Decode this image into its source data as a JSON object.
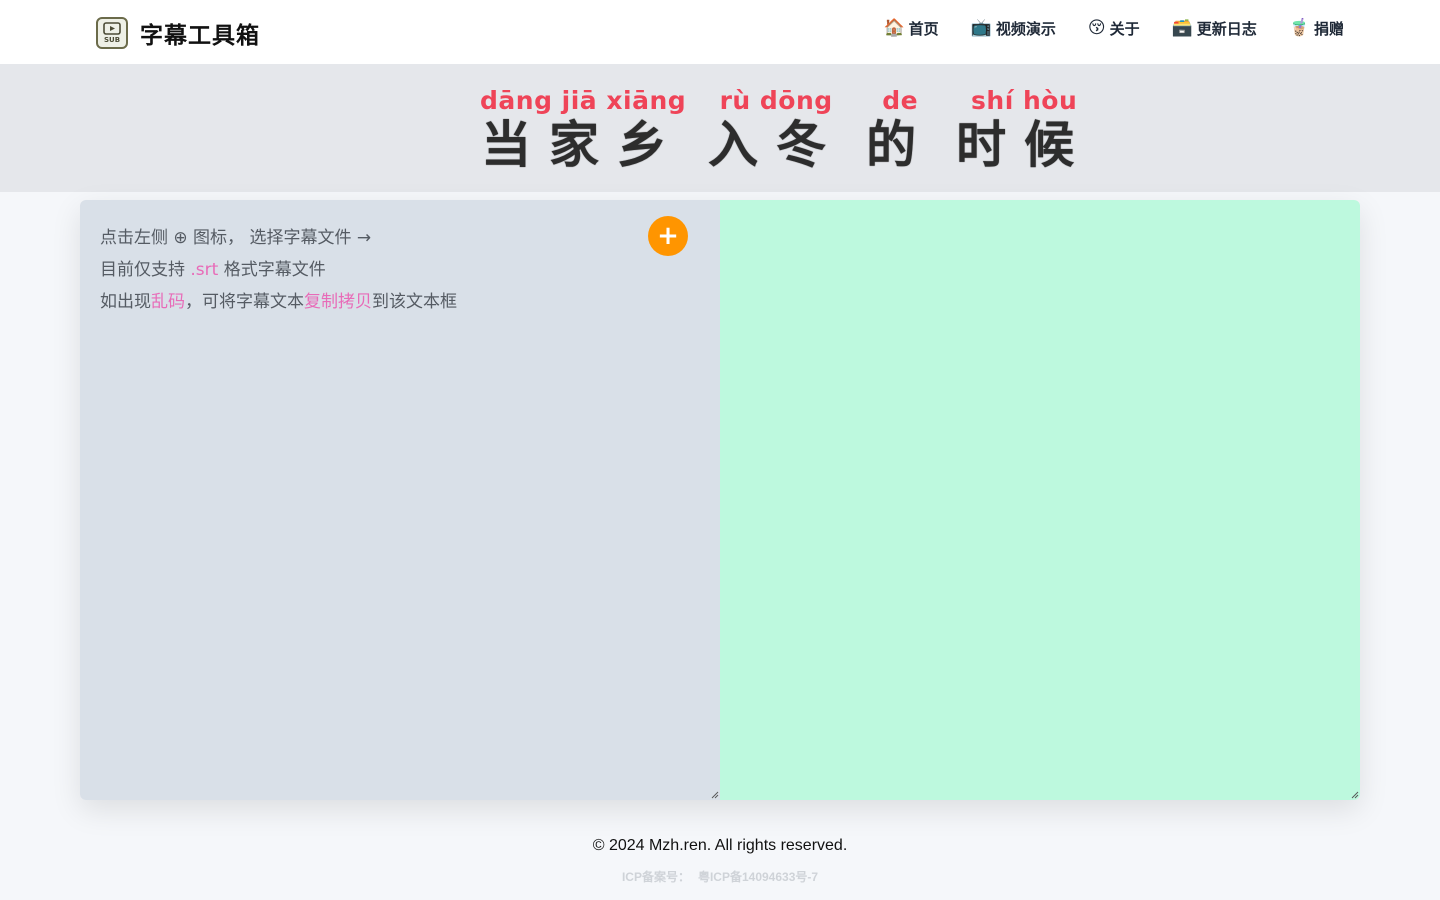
{
  "header": {
    "title": "字幕工具箱",
    "logo_text": "SUB",
    "nav": [
      {
        "icon": "🏠",
        "icon_name": "house-icon",
        "label": "首页"
      },
      {
        "icon": "📺",
        "icon_name": "television-icon",
        "label": "视频演示"
      },
      {
        "icon": "😚",
        "icon_name": "kissing-face-icon",
        "label": "关于"
      },
      {
        "icon": "🗃️",
        "icon_name": "card-file-box-icon",
        "label": "更新日志"
      },
      {
        "icon": "🧋",
        "icon_name": "bubble-tea-icon",
        "label": "捐赠"
      }
    ]
  },
  "banner": {
    "words": [
      {
        "pinyin": "dāng jiā xiāng",
        "hanzi": "当家乡"
      },
      {
        "pinyin": "rù dōng",
        "hanzi": "入冬"
      },
      {
        "pinyin": "de",
        "hanzi": "的"
      },
      {
        "pinyin": "shí hòu",
        "hanzi": "时候"
      }
    ]
  },
  "editor": {
    "hint": {
      "line1": "点击左侧 ⊕ 图标， 选择字幕文件 →",
      "line2_pre": "目前仅支持 ",
      "line2_hl": ".srt",
      "line2_post": " 格式字幕文件",
      "line3_pre": "如出现",
      "line3_hl1": "乱码",
      "line3_mid": "，可将字幕文本",
      "line3_hl2": "复制拷贝",
      "line3_post": "到该文本框"
    },
    "add_button": "+",
    "output_text": ""
  },
  "footer": {
    "copyright": "© 2024 Mzh.ren. All rights reserved.",
    "icp_label": "ICP备案号：",
    "icp_number": "粤ICP备14094633号-7"
  },
  "colors": {
    "accent": "#ff9500",
    "highlight": "#e86bb8",
    "pinyin": "#ef4458",
    "left_panel": "#d9e0e8",
    "right_panel": "#bdf9de"
  }
}
